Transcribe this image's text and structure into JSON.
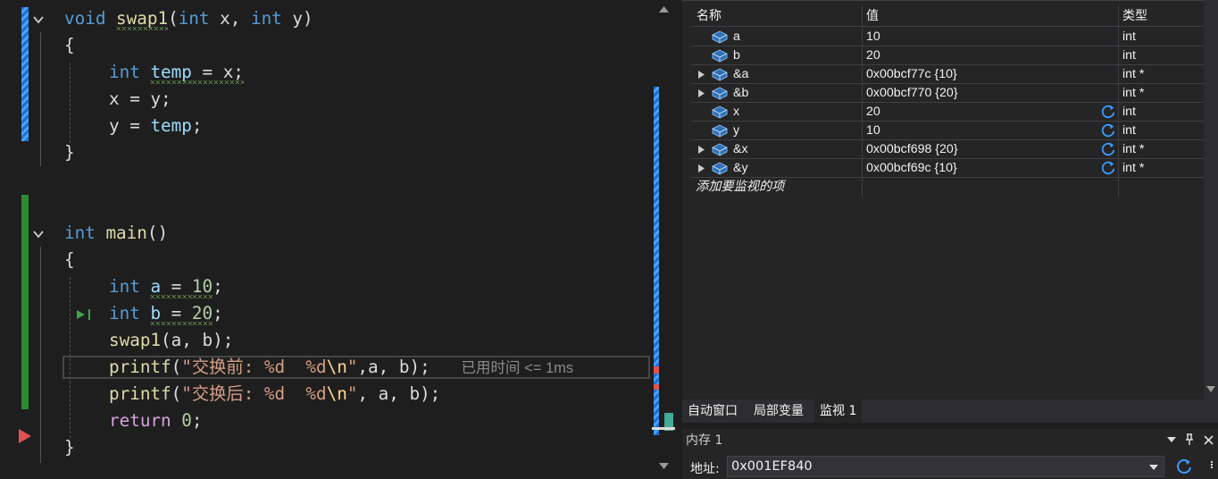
{
  "editor": {
    "lines": {
      "l1": {
        "kw1": "void",
        "fn": "swap1",
        "p1": "(",
        "kw2": "int",
        "a1": " x, ",
        "kw3": "int",
        "a2": " y)"
      },
      "l2": "{",
      "l3": {
        "kw": "int",
        "v": "temp",
        "rest": " = x;"
      },
      "l4": "x = y;",
      "l5": {
        "v": "y",
        "op": " = ",
        "v2": "temp",
        ";": ";"
      },
      "l6": "}",
      "l8": {
        "kw": "int",
        "fn": "main",
        "rest": "()"
      },
      "l9": "{",
      "l10": {
        "kw": "int",
        "v": "a",
        "op": " = ",
        "n": "10",
        ";": ";"
      },
      "l11": {
        "kw": "int",
        "v": "b",
        "op": " = ",
        "n": "20",
        ";": ";"
      },
      "l12": {
        "fn": "swap1",
        "rest": "(a, b);"
      },
      "l13": {
        "fn": "printf",
        "p": "(",
        "s1": "\"交换前: %d  %d",
        "esc": "\\n",
        "s2": "\"",
        "rest": ",a, b);",
        "hint": "已用时间 <= 1ms"
      },
      "l14": {
        "fn": "printf",
        "p": "(",
        "s1": "\"交换后: %d  %d",
        "esc": "\\n",
        "s2": "\"",
        "rest": ", a, b);"
      },
      "l15": {
        "kw": "return",
        "n": "0",
        ";": ";"
      },
      "l16": "}"
    }
  },
  "watch": {
    "headers": {
      "name": "名称",
      "value": "值",
      "type": "类型"
    },
    "rows": [
      {
        "name": "a",
        "value": "10",
        "type": "int",
        "expand": false,
        "refresh": false
      },
      {
        "name": "b",
        "value": "20",
        "type": "int",
        "expand": false,
        "refresh": false
      },
      {
        "name": "&a",
        "value": "0x00bcf77c {10}",
        "type": "int *",
        "expand": true,
        "refresh": false
      },
      {
        "name": "&b",
        "value": "0x00bcf770 {20}",
        "type": "int *",
        "expand": true,
        "refresh": false
      },
      {
        "name": "x",
        "value": "20",
        "type": "int",
        "expand": false,
        "refresh": true
      },
      {
        "name": "y",
        "value": "10",
        "type": "int",
        "expand": false,
        "refresh": true
      },
      {
        "name": "&x",
        "value": "0x00bcf698 {20}",
        "type": "int *",
        "expand": true,
        "refresh": true
      },
      {
        "name": "&y",
        "value": "0x00bcf69c {10}",
        "type": "int *",
        "expand": true,
        "refresh": true
      }
    ],
    "add_item": "添加要监视的项"
  },
  "tabs": {
    "autos": "自动窗口",
    "locals": "局部变量",
    "watch1": "监视 1"
  },
  "memory": {
    "title": "内存 1",
    "address_label": "地址:",
    "address_value": "0x001EF840"
  },
  "colors": {
    "breakpoint": "#e05252",
    "green_bar": "#2ea043",
    "blue_bar": "#2b7fd4"
  }
}
